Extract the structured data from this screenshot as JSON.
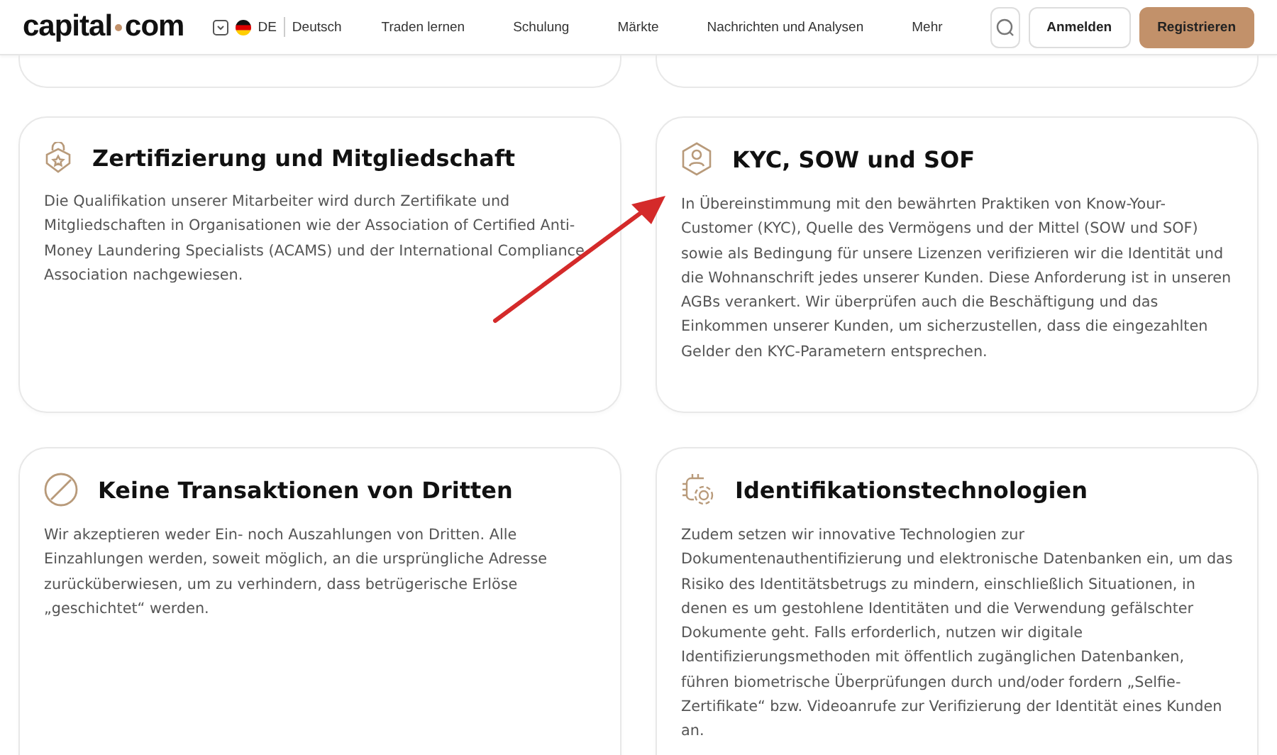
{
  "header": {
    "logo": [
      "capital",
      "com"
    ],
    "language_code": "DE",
    "language": "Deutsch",
    "nav": [
      "Traden lernen",
      "Schulung",
      "Märkte",
      "Nachrichten und Analysen",
      "Mehr"
    ],
    "login": "Anmelden",
    "register": "Registrieren"
  },
  "cards": [
    {
      "title": "Zertifizierung und Mitgliedschaft",
      "text": "Die Qualifikation unserer Mitarbeiter wird durch Zertifikate und Mitgliedschaften in Organisationen wie der Association of Certified Anti-Money Laundering Specialists (ACAMS) und der International Compliance Association nachgewiesen."
    },
    {
      "title": "KYC, SOW und SOF",
      "text": "In Übereinstimmung mit den bewährten Praktiken von Know-Your-Customer (KYC), Quelle des Vermögens und der Mittel (SOW und SOF) sowie als Bedingung für unsere Lizenzen verifizieren wir die Identität und die Wohnanschrift jedes unserer Kunden. Diese Anforderung ist in unseren AGBs verankert. Wir überprüfen auch die Beschäftigung und das Einkommen unserer Kunden, um sicherzustellen, dass die eingezahlten Gelder den KYC-Parametern entsprechen."
    },
    {
      "title": "Keine Transaktionen von Dritten",
      "text": "Wir akzeptieren weder Ein- noch Auszahlungen von Dritten. Alle Einzahlungen werden, soweit möglich, an die ursprüngliche Adresse zurücküberwiesen, um zu verhindern, dass betrügerische Erlöse „geschichtet“ werden."
    },
    {
      "title": "Identifikationstechnologien",
      "text": "Zudem setzen wir innovative Technologien zur Dokumentenauthentifizierung und elektronische Datenbanken ein, um das Risiko des Identitätsbetrugs zu mindern, einschließlich Situationen, in denen es um gestohlene Identitäten und die Verwendung gefälschter Dokumente geht. Falls erforderlich, nutzen wir digitale Identifizierungsmethoden mit öffentlich zugänglichen Datenbanken, führen biometrische Überprüfungen durch und/oder fordern „Selfie-Zertifikate“ bzw. Videoanrufe zur Verifizierung der Identität eines Kunden an."
    }
  ]
}
